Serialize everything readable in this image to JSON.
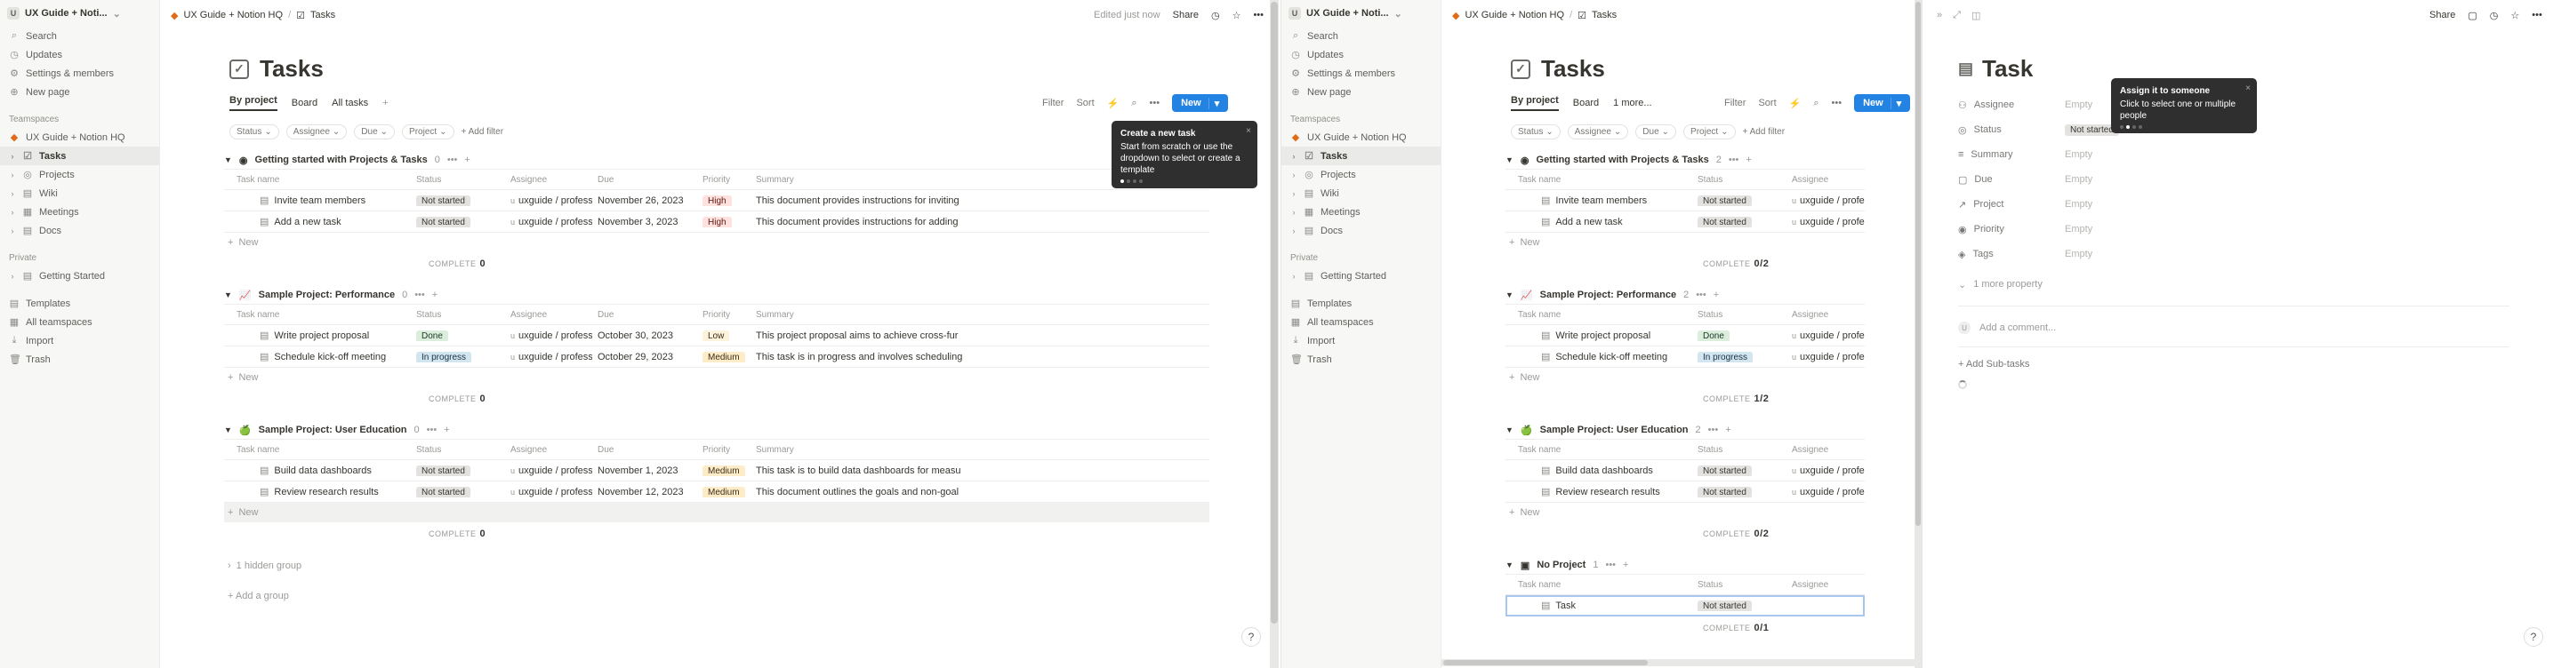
{
  "workspace": {
    "initial": "U",
    "name": "UX Guide + Noti..."
  },
  "sidebar": {
    "top": [
      {
        "icon": "search-icon",
        "glyph": "⌕",
        "label": "Search"
      },
      {
        "icon": "clock-icon",
        "glyph": "◷",
        "label": "Updates"
      },
      {
        "icon": "gear-icon",
        "glyph": "⚙",
        "label": "Settings & members"
      },
      {
        "icon": "plus-circle-icon",
        "glyph": "⊕",
        "label": "New page"
      }
    ],
    "teamspaces_label": "Teamspaces",
    "teamspace": "UX Guide + Notion HQ",
    "pages": [
      "Tasks",
      "Projects",
      "Wiki",
      "Meetings",
      "Docs"
    ],
    "private_label": "Private",
    "private_pages": [
      "Getting Started"
    ],
    "bottom": [
      {
        "icon": "template-icon",
        "glyph": "▤",
        "label": "Templates"
      },
      {
        "icon": "teamspaces-icon",
        "glyph": "▦",
        "label": "All teamspaces"
      },
      {
        "icon": "import-icon",
        "glyph": "⤓",
        "label": "Import"
      },
      {
        "icon": "trash-icon",
        "glyph": "🗑",
        "label": "Trash"
      }
    ]
  },
  "breadcrumb": {
    "workspace": "UX Guide + Notion HQ",
    "page": "Tasks"
  },
  "topbar": {
    "edited": "Edited just now",
    "share": "Share"
  },
  "page_title": "Tasks",
  "views_left": [
    "By project",
    "Board",
    "All tasks"
  ],
  "views_right": [
    "By project",
    "Board",
    "1 more..."
  ],
  "toolbar": {
    "filter": "Filter",
    "sort": "Sort",
    "new": "New"
  },
  "filters": [
    "Status",
    "Assignee",
    "Due",
    "Project"
  ],
  "add_filter": "+ Add filter",
  "columns": {
    "task": "Task name",
    "status": "Status",
    "assignee": "Assignee",
    "due": "Due",
    "priority": "Priority",
    "summary": "Summary"
  },
  "groups_left": [
    {
      "emoji": "◉",
      "name": "Getting started with Projects & Tasks",
      "count": "0",
      "complete": "0",
      "rows": [
        {
          "name": "Invite team members",
          "status": "Not started",
          "st": "ns",
          "assignee": "uxguide / professi",
          "due": "November 26, 2023",
          "priority": "High",
          "pr": "high",
          "summary": "This document provides instructions for inviting"
        },
        {
          "name": "Add a new task",
          "status": "Not started",
          "st": "ns",
          "assignee": "uxguide / professi",
          "due": "November 3, 2023",
          "priority": "High",
          "pr": "high",
          "summary": "This document provides instructions for adding"
        }
      ]
    },
    {
      "emoji": "📈",
      "name": "Sample Project: Performance",
      "count": "0",
      "complete": "0",
      "rows": [
        {
          "name": "Write project proposal",
          "status": "Done",
          "st": "done",
          "assignee": "uxguide / professi",
          "due": "October 30, 2023",
          "priority": "Low",
          "pr": "low",
          "summary": "This project proposal aims to achieve cross-fur"
        },
        {
          "name": "Schedule kick-off meeting",
          "status": "In progress",
          "st": "ip",
          "assignee": "uxguide / professi",
          "due": "October 29, 2023",
          "priority": "Medium",
          "pr": "med",
          "summary": "This task is in progress and involves scheduling"
        }
      ]
    },
    {
      "emoji": "🍏",
      "name": "Sample Project: User Education",
      "count": "0",
      "complete": "0",
      "rows": [
        {
          "name": "Build data dashboards",
          "status": "Not started",
          "st": "ns",
          "assignee": "uxguide / professi",
          "due": "November 1, 2023",
          "priority": "Medium",
          "pr": "med",
          "summary": "This task is to build data dashboards for measu"
        },
        {
          "name": "Review research results",
          "status": "Not started",
          "st": "ns",
          "assignee": "uxguide / professi",
          "due": "November 12, 2023",
          "priority": "Medium",
          "pr": "med",
          "summary": "This document outlines the goals and non-goal"
        }
      ]
    }
  ],
  "groups_right": [
    {
      "emoji": "◉",
      "name": "Getting started with Projects & Tasks",
      "count": "2",
      "complete": "0/2"
    },
    {
      "emoji": "📈",
      "name": "Sample Project: Performance",
      "count": "2",
      "complete": "1/2"
    },
    {
      "emoji": "🍏",
      "name": "Sample Project: User Education",
      "count": "2",
      "complete": "0/2"
    },
    {
      "emoji": "▣",
      "name": "No Project",
      "count": "1",
      "complete": "0/1"
    }
  ],
  "no_project_row": {
    "name": "Task",
    "status": "Not started"
  },
  "new_label": "New",
  "complete_label": "COMPLETE",
  "hidden_group": "1 hidden group",
  "add_group": "+ Add a group",
  "tooltip_left": {
    "title": "Create a new task",
    "body": "Start from scratch or use the dropdown to select or create a template"
  },
  "tooltip_right": {
    "title": "Assign it to someone",
    "body": "Click to select one or multiple people"
  },
  "task_panel": {
    "title": "Task",
    "props": [
      {
        "icon": "person-icon",
        "glyph": "⚇",
        "label": "Assignee",
        "value": "Empty"
      },
      {
        "icon": "status-icon",
        "glyph": "◎",
        "label": "Status",
        "value": "Not started"
      },
      {
        "icon": "summary-icon",
        "glyph": "≡",
        "label": "Summary",
        "value": "Empty"
      },
      {
        "icon": "calendar-icon",
        "glyph": "▢",
        "label": "Due",
        "value": "Empty"
      },
      {
        "icon": "project-icon",
        "glyph": "↗",
        "label": "Project",
        "value": "Empty"
      },
      {
        "icon": "priority-icon",
        "glyph": "◉",
        "label": "Priority",
        "value": "Empty"
      },
      {
        "icon": "tag-icon",
        "glyph": "◈",
        "label": "Tags",
        "value": "Empty"
      }
    ],
    "more": "1 more property",
    "comment": "Add a comment...",
    "subtasks": "+ Add Sub-tasks",
    "share": "Share"
  },
  "help": "?"
}
